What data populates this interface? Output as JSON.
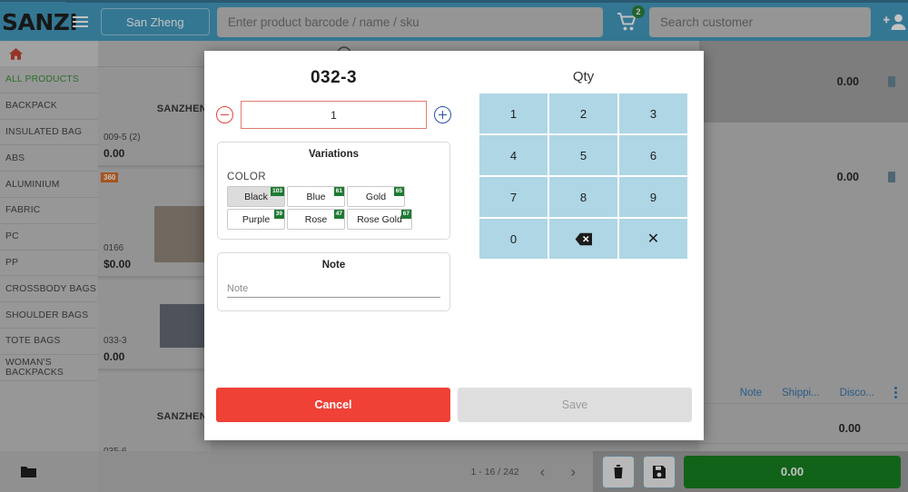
{
  "header": {
    "logo_text": "SANZI",
    "menu_icon": "hamburger-icon",
    "store_name": "San Zheng",
    "barcode_placeholder": "Enter product barcode / name / sku",
    "barcode_value": "",
    "cart_icon": "shopping-cart-icon",
    "cart_count": "2",
    "customer_placeholder": "Search customer",
    "customer_value": "",
    "add_customer_icon": "add-person-icon"
  },
  "sidebar": {
    "home_icon": "home-icon",
    "items": [
      {
        "label": "ALL PRODUCTS",
        "active": true
      },
      {
        "label": "BACKPACK",
        "active": false
      },
      {
        "label": "INSULATED BAG",
        "active": false
      },
      {
        "label": "ABS",
        "active": false
      },
      {
        "label": "ALUMINIUM",
        "active": false
      },
      {
        "label": "FABRIC",
        "active": false
      },
      {
        "label": "PC",
        "active": false
      },
      {
        "label": "PP",
        "active": false
      },
      {
        "label": "CROSSBODY BAGS",
        "active": false
      },
      {
        "label": "SHOULDER BAGS",
        "active": false
      },
      {
        "label": "TOTE BAGS",
        "active": false
      },
      {
        "label": "WOMAN'S BACKPACKS",
        "active": false
      }
    ]
  },
  "products": [
    {
      "sku": "009-5  (2)",
      "price": "0.00",
      "badge": "",
      "watermark": "SANZHEN"
    },
    {
      "sku": "0166",
      "price": "$0.00",
      "badge": "360",
      "watermark": ""
    },
    {
      "sku": "033-3",
      "price": "0.00",
      "badge": "",
      "watermark": ""
    },
    {
      "sku": "035-6",
      "price": "0.00",
      "badge": "",
      "watermark": "SANZHEN"
    }
  ],
  "cart": {
    "rows": [
      {
        "amount": "0.00",
        "delete_icon": "trash-icon"
      },
      {
        "amount": "0.00",
        "delete_icon": "trash-icon"
      }
    ],
    "links": [
      {
        "label": "Note"
      },
      {
        "label": "Shippi..."
      },
      {
        "label": "Disco..."
      }
    ],
    "menu_icon": "kebab-menu-icon",
    "subtotal": "0.00"
  },
  "footer": {
    "folder_icon": "folder-icon",
    "pagination": "1 - 16 / 242",
    "prev_icon": "chevron-left-icon",
    "next_icon": "chevron-right-icon",
    "clear_icon": "trash-icon",
    "save_icon": "floppy-disk-icon",
    "total": "0.00"
  },
  "modal": {
    "title": "032-3",
    "decrease_icon": "minus-circle-icon",
    "increase_icon": "plus-circle-icon",
    "qty_value": "1",
    "variations_title": "Variations",
    "attribute_label": "COLOR",
    "variations": [
      {
        "label": "Black",
        "badge": "103",
        "selected": true
      },
      {
        "label": "Blue",
        "badge": "61",
        "selected": false
      },
      {
        "label": "Gold",
        "badge": "65",
        "selected": false
      },
      {
        "label": "Purple",
        "badge": "39",
        "selected": false
      },
      {
        "label": "Rose",
        "badge": "47",
        "selected": false
      },
      {
        "label": "Rose Gold",
        "badge": "67",
        "selected": false
      }
    ],
    "note_title": "Note",
    "note_placeholder": "Note",
    "note_value": "",
    "keypad_title": "Qty",
    "keys": [
      {
        "label": "1",
        "type": "digit"
      },
      {
        "label": "2",
        "type": "digit"
      },
      {
        "label": "3",
        "type": "digit"
      },
      {
        "label": "4",
        "type": "digit"
      },
      {
        "label": "5",
        "type": "digit"
      },
      {
        "label": "6",
        "type": "digit"
      },
      {
        "label": "7",
        "type": "digit"
      },
      {
        "label": "8",
        "type": "digit"
      },
      {
        "label": "9",
        "type": "digit"
      },
      {
        "label": "0",
        "type": "digit"
      },
      {
        "label": "",
        "type": "backspace-icon"
      },
      {
        "label": "✕",
        "type": "clear-icon"
      }
    ],
    "cancel_label": "Cancel",
    "save_label": "Save"
  },
  "colors": {
    "header_bg": "#3a96bd",
    "accent_green": "#0a7a16",
    "cancel_red": "#ef4136",
    "keypad_blue": "#aed6e4",
    "badge_green": "#1f7a33",
    "link_blue": "#2a6ea8"
  }
}
